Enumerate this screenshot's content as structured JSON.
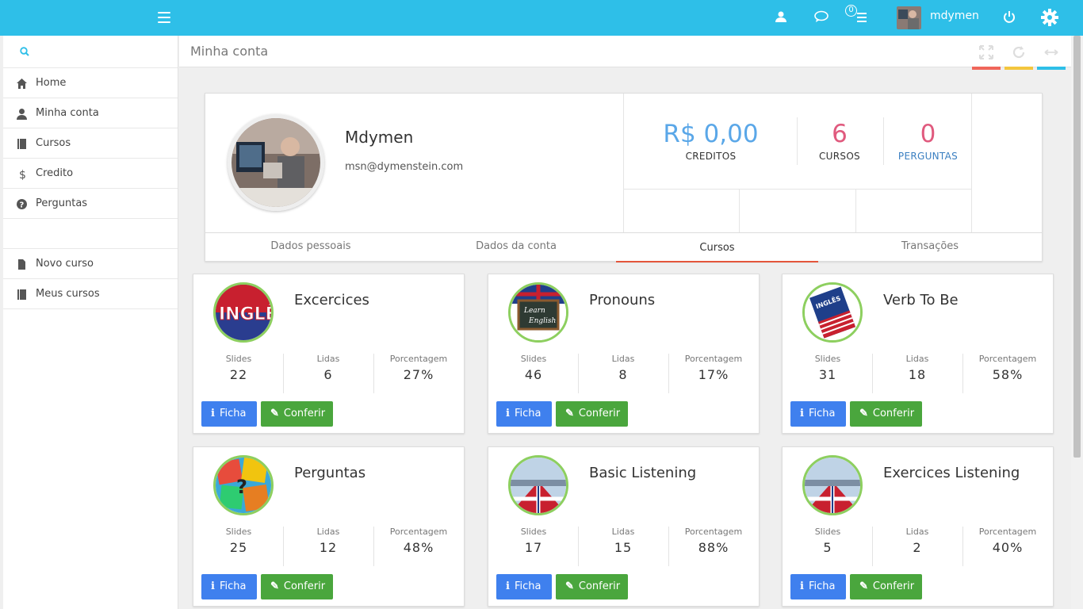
{
  "topbar": {
    "username": "mdymen",
    "notif_count": "0",
    "colors": {
      "bar": "#2ebfe8"
    }
  },
  "sidebar": {
    "search_placeholder": "",
    "items": [
      {
        "label": "Home",
        "icon": "home-icon"
      },
      {
        "label": "Minha conta",
        "icon": "user-icon"
      },
      {
        "label": "Cursos",
        "icon": "book-icon"
      },
      {
        "label": "Credito",
        "icon": "dollar-icon"
      },
      {
        "label": "Perguntas",
        "icon": "question-icon"
      }
    ],
    "items2": [
      {
        "label": "Novo curso",
        "icon": "file-icon"
      },
      {
        "label": "Meus cursos",
        "icon": "book-icon"
      }
    ]
  },
  "page": {
    "title": "Minha conta"
  },
  "profile": {
    "name": "Mdymen",
    "email": "msn@dymenstein.com",
    "stats": [
      {
        "value": "R$ 0,00",
        "caption": "CREDITOS",
        "color": "#5aa7e8"
      },
      {
        "value": "6",
        "caption": "CURSOS",
        "color": "#e05a7e"
      },
      {
        "value": "0",
        "caption": "PERGUNTAS",
        "color": "#e05a7e"
      }
    ],
    "tabs": [
      "Dados pessoais",
      "Dados da conta",
      "Cursos",
      "Transações"
    ],
    "active_tab": "Cursos"
  },
  "labels": {
    "slides": "Slides",
    "lidas": "Lidas",
    "porcentagem": "Porcentagem",
    "ficha": "Ficha",
    "conferir": "Conferir"
  },
  "courses": [
    {
      "title": "Excercices",
      "slides": "22",
      "lidas": "6",
      "pct": "27%"
    },
    {
      "title": "Pronouns",
      "slides": "46",
      "lidas": "8",
      "pct": "17%"
    },
    {
      "title": "Verb To Be",
      "slides": "31",
      "lidas": "18",
      "pct": "58%"
    },
    {
      "title": "Perguntas",
      "slides": "25",
      "lidas": "12",
      "pct": "48%"
    },
    {
      "title": "Basic Listening",
      "slides": "17",
      "lidas": "15",
      "pct": "88%"
    },
    {
      "title": "Exercices Listening",
      "slides": "5",
      "lidas": "2",
      "pct": "40%"
    }
  ]
}
